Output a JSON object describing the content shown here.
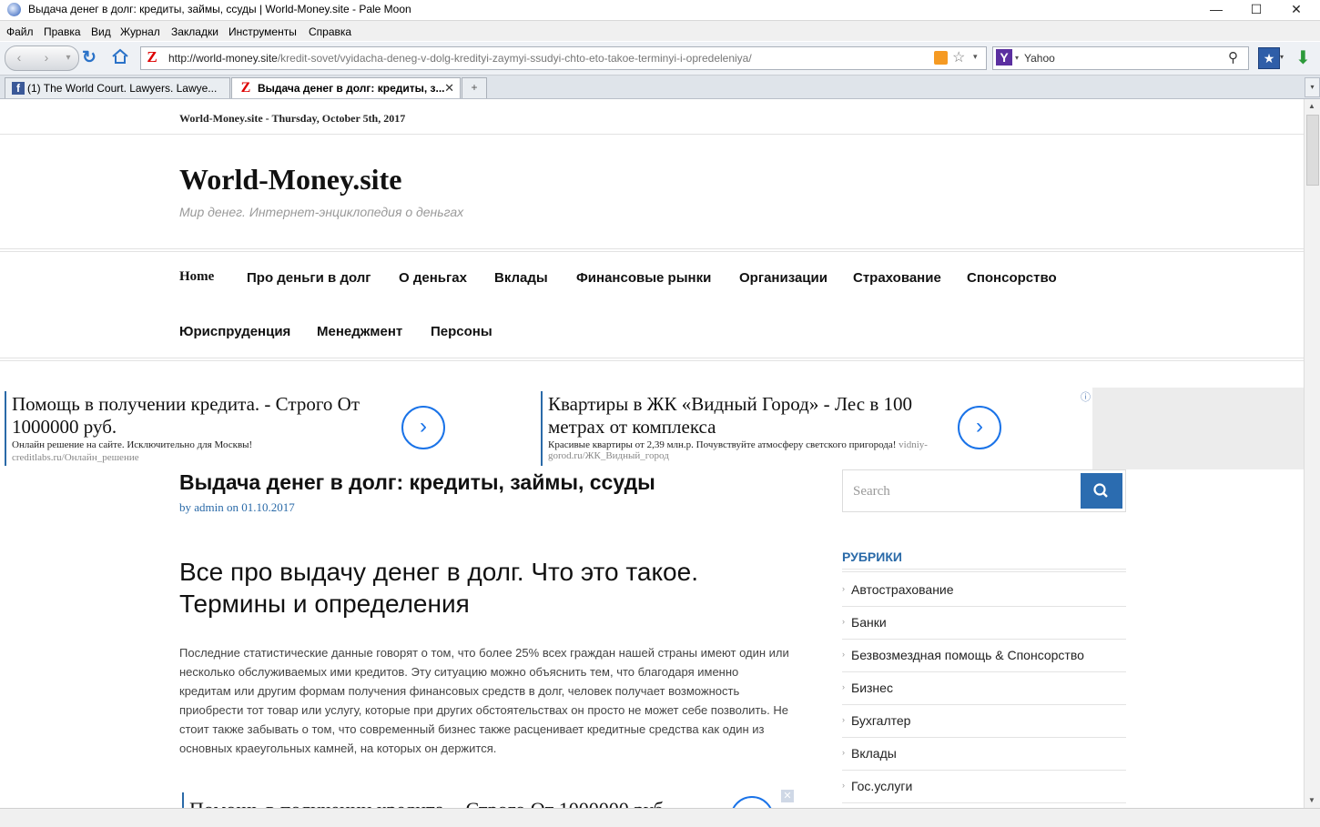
{
  "window": {
    "title": "Выдача денег в долг: кредиты, займы, ссуды | World-Money.site - Pale Moon",
    "minimize": "—",
    "maximize": "☐",
    "close": "✕"
  },
  "menu": [
    "Файл",
    "Правка",
    "Вид",
    "Журнал",
    "Закладки",
    "Инструменты",
    "Справка"
  ],
  "toolbar": {
    "url_host": "http://world-money.site",
    "url_path": "/kredit-sovet/vyidacha-deneg-v-dolg-kredityi-zaymyi-ssudyi-chto-eto-takoe-terminyi-i-opredeleniya/",
    "search_engine_letter": "Y",
    "search_placeholder": "Yahoo"
  },
  "tabs": [
    {
      "label": "(1) The World Court. Lawyers. Lawye...",
      "icon": "facebook-icon"
    },
    {
      "label": "Выдача денег в долг: кредиты, з...",
      "icon": "z-icon"
    }
  ],
  "site": {
    "topline": "World-Money.site - Thursday, October 5th, 2017",
    "name": "World-Money.site",
    "tagline": "Мир денег. Интернет-энциклопедия о деньгах",
    "nav_row1": [
      "Home",
      "Про деньги в долг",
      "О деньгах",
      "Вклады",
      "Финансовые рынки",
      "Организации",
      "Страхование",
      "Спонсорство"
    ],
    "nav_row2": [
      "Юриспруденция",
      "Менеджмент",
      "Персоны"
    ]
  },
  "ads": [
    {
      "title": "Помощь в получении кредита. - Строго От 1000000 руб.",
      "desc": "Онлайн решение на сайте. Исключительно для Москвы!",
      "source": "creditlabs.ru/Онлайн_решение"
    },
    {
      "title": "Квартиры в ЖК «Видный Город» - Лес в 100 метрах от комплекса",
      "desc": "Красивые квартиры от 2,39 млн.р. Почувствуйте атмосферу светского пригорода!",
      "source": "vidniy-gorod.ru/ЖК_Видный_город"
    }
  ],
  "article": {
    "title": "Выдача денег в долг: кредиты, займы, ссуды",
    "by": "by",
    "author": "admin",
    "on": "on",
    "date": "01.10.2017",
    "subtitle": "Все про выдачу денег в долг.  Что это такое. Термины и определения",
    "body": "Последние статистические данные говорят о том, что более 25% всех граждан нашей страны имеют один или несколько обслуживаемых ими кредитов. Эту ситуацию можно объяснить тем, что благодаря именно кредитам или другим формам получения финансовых средств в долг, человек получает возможность приобрести тот товар или услугу, которые при других обстоятельствах он просто не может себе позволить. Не стоит также забывать о том, что современный бизнес также расценивает кредитные средства как один из основных краеугольных камней, на которых он держится.",
    "inline_ad": "Помощь в получении кредита. - Строго От 1000000 руб."
  },
  "sidebar": {
    "search_placeholder": "Search",
    "rubrics_title": "РУБРИКИ",
    "categories": [
      "Автострахование",
      "Банки",
      "Безвозмездная помощь & Спонсорство",
      "Бизнес",
      "Бухгалтер",
      "Вклады",
      "Гос.услуги"
    ]
  },
  "colors": {
    "accent": "#2b6cb0",
    "rubric": "#2a6aa8",
    "link": "#2a6aa8",
    "ad_chevron": "#1a73e8"
  }
}
